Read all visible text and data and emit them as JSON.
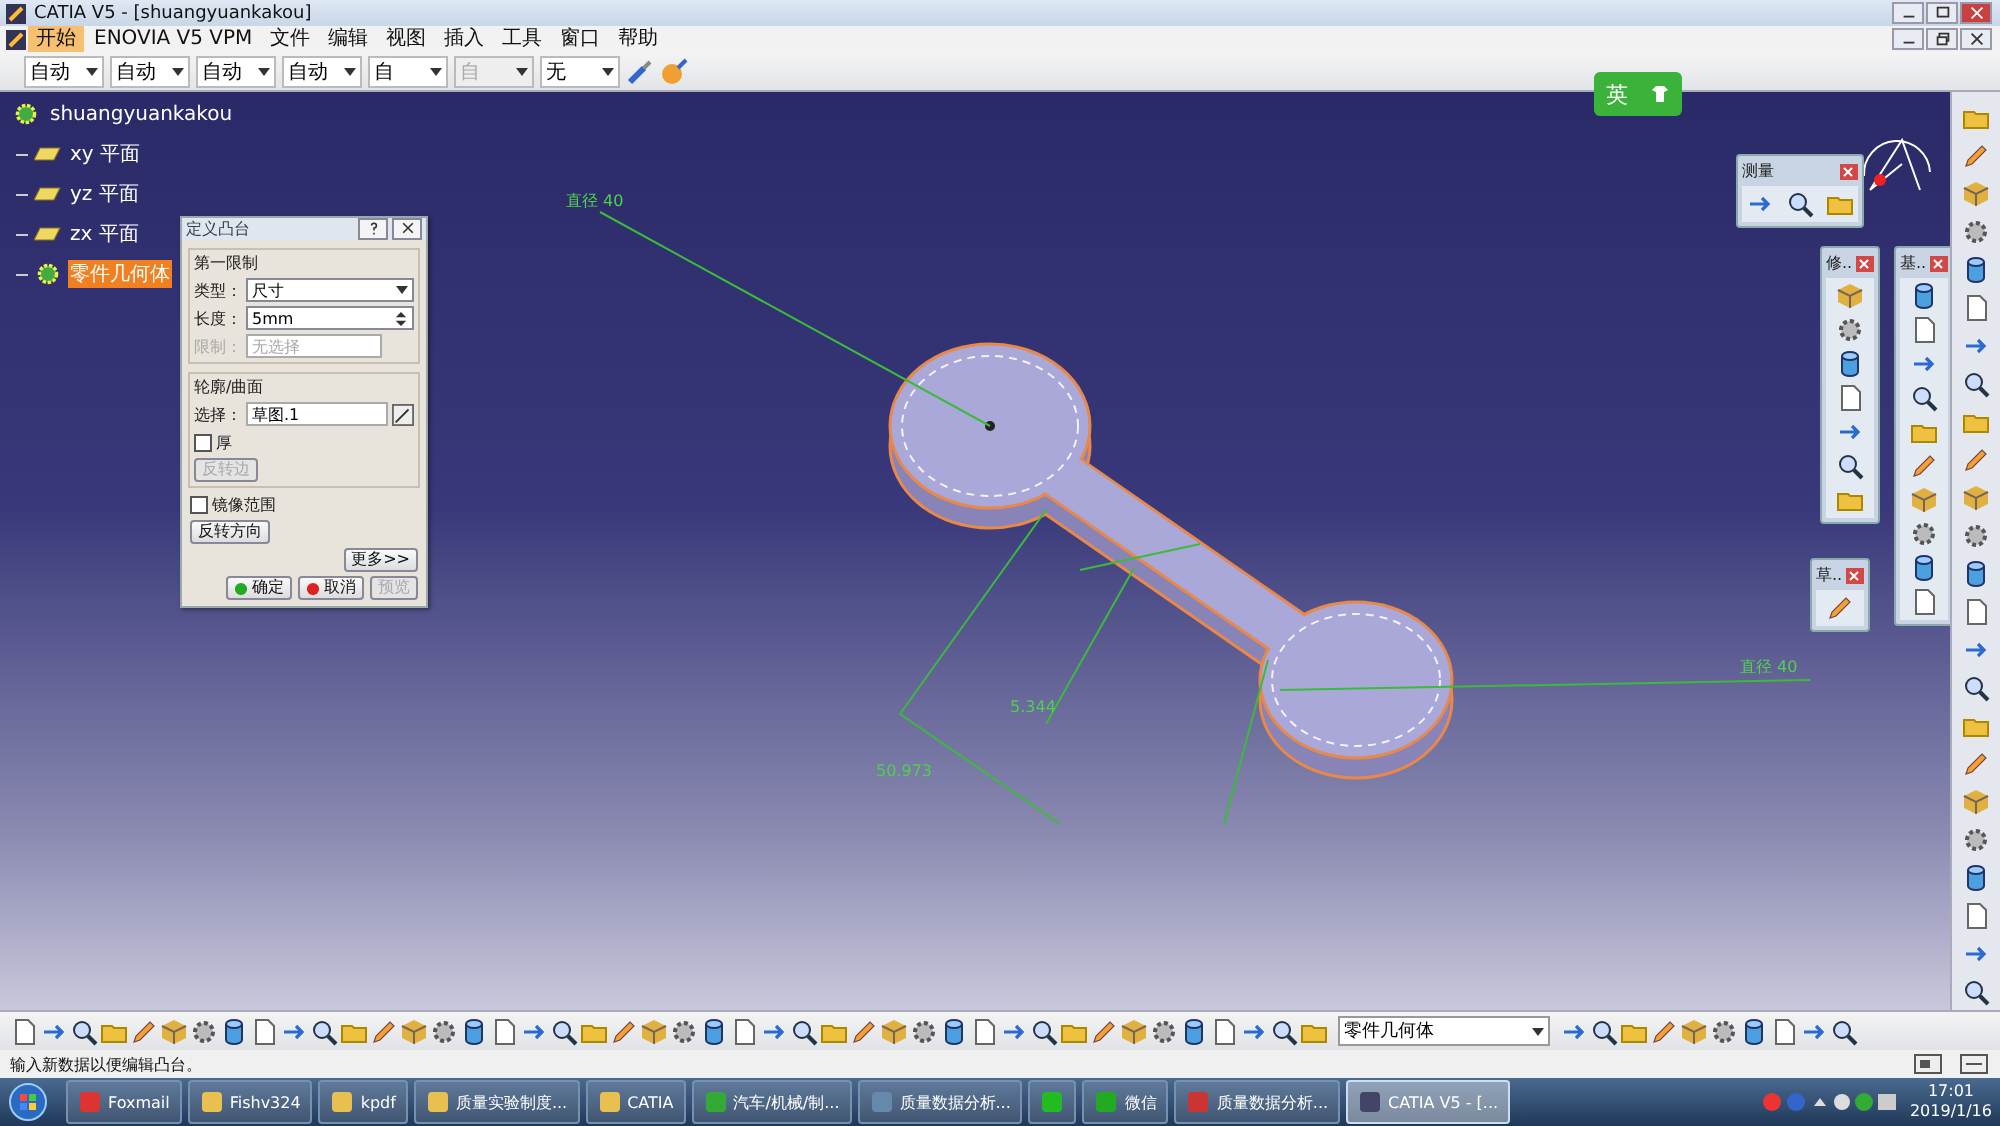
{
  "window": {
    "title": "CATIA V5 - [shuangyuankakou]"
  },
  "menu": [
    {
      "label": "开始",
      "selected": true
    },
    {
      "label": "ENOVIA V5 VPM",
      "selected": false
    },
    {
      "label": "文件",
      "selected": false
    },
    {
      "label": "编辑",
      "selected": false
    },
    {
      "label": "视图",
      "selected": false
    },
    {
      "label": "插入",
      "selected": false
    },
    {
      "label": "工具",
      "selected": false
    },
    {
      "label": "窗口",
      "selected": false
    },
    {
      "label": "帮助",
      "selected": false
    }
  ],
  "toolbar": {
    "dropdowns": [
      {
        "value": "自动",
        "disabled": false
      },
      {
        "value": "自动",
        "disabled": false
      },
      {
        "value": "自动",
        "disabled": false
      },
      {
        "value": "自动",
        "disabled": false
      },
      {
        "value": "自",
        "disabled": false
      },
      {
        "value": "自",
        "disabled": true
      },
      {
        "value": "无",
        "disabled": false
      }
    ]
  },
  "ime": {
    "label": "英"
  },
  "tree": {
    "root": "shuangyuankakou",
    "children": [
      {
        "label": "xy 平面",
        "kind": "plane",
        "selected": false
      },
      {
        "label": "yz 平面",
        "kind": "plane",
        "selected": false
      },
      {
        "label": "zx 平面",
        "kind": "plane",
        "selected": false
      },
      {
        "label": "零件几何体",
        "kind": "body",
        "selected": true
      }
    ]
  },
  "dialog": {
    "title": "定义凸台",
    "first_limit": {
      "title": "第一限制",
      "type_label": "类型：",
      "type_value": "尺寸",
      "length_label": "长度：",
      "length_value": "5mm",
      "limit_label": "限制：",
      "limit_value": "无选择",
      "limit_disabled": true
    },
    "profile": {
      "title": "轮廓/曲面",
      "select_label": "选择：",
      "select_value": "草图.1",
      "thick": {
        "label": "厚",
        "checked": false
      },
      "reverse_side": {
        "label": "反转边",
        "disabled": true
      }
    },
    "mirror": {
      "label": "镜像范围",
      "checked": false
    },
    "reverse_direction": "反转方向",
    "more": "更多>>",
    "buttons": [
      {
        "label": "确定",
        "kind": "ok",
        "disabled": false
      },
      {
        "label": "取消",
        "kind": "cancel",
        "disabled": false
      },
      {
        "label": "预览",
        "kind": "preview",
        "disabled": true
      }
    ]
  },
  "canvas": {
    "labels": [
      "直径 40",
      "直径 40",
      "5.344",
      "50.973"
    ]
  },
  "floating_toolbars": [
    {
      "title": "测量"
    },
    {
      "title": "修.."
    },
    {
      "title": "基.."
    },
    {
      "title": "草.."
    }
  ],
  "bottom_toolbar": {
    "dropdown": "零件几何体"
  },
  "status_bar": {
    "text": "输入新数据以便编辑凸台。"
  },
  "taskbar": {
    "items": [
      {
        "label": "Foxmail",
        "kind": "mail",
        "selected": false
      },
      {
        "label": "Fishv324",
        "kind": "folder",
        "selected": false
      },
      {
        "label": "kpdf",
        "kind": "folder",
        "selected": false
      },
      {
        "label": "质量实验制度...",
        "kind": "folder",
        "selected": false
      },
      {
        "label": "CATIA",
        "kind": "folder",
        "selected": false
      },
      {
        "label": "汽车/机械/制...",
        "kind": "browser",
        "selected": false
      },
      {
        "label": "质量数据分析...",
        "kind": "doc",
        "selected": false
      },
      {
        "kind": "app",
        "selected": false
      },
      {
        "label": "微信",
        "kind": "chat",
        "selected": false
      },
      {
        "label": "质量数据分析...",
        "kind": "pdf",
        "selected": false
      },
      {
        "label": "CATIA V5 - [...",
        "kind": "catia",
        "selected": true
      }
    ],
    "clock": {
      "time": "17:01",
      "date": "2019/1/16"
    }
  }
}
